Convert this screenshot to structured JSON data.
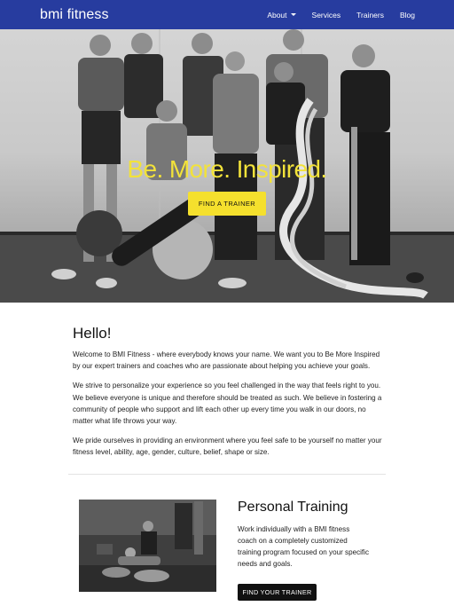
{
  "navbar": {
    "brand": "bmi fitness",
    "items": [
      {
        "label": "About",
        "has_dropdown": true
      },
      {
        "label": "Services"
      },
      {
        "label": "Trainers"
      },
      {
        "label": "Blog"
      }
    ]
  },
  "hero": {
    "title": "Be. More. Inspired.",
    "button_label": "FIND A TRAINER"
  },
  "intro": {
    "heading": "Hello!",
    "paragraphs": [
      "Welcome to BMI Fitness - where everybody knows your name. We want you to Be More Inspired by our expert trainers and coaches who are passionate about helping you achieve your goals.",
      "We strive to personalize your experience so you feel challenged in the way that feels right to you. We believe everyone is unique and therefore should be treated as such. We believe in fostering a community of people who support and lift each other up every time you walk in our doors, no matter what life throws your way.",
      "We pride ourselves in providing an environment where you feel safe to be yourself no matter your fitness level, ability, age, gender, culture, belief, shape or size."
    ]
  },
  "personal_training": {
    "title": "Personal Training",
    "description": "Work individually with a BMI fitness coach on a completely customized training program focused on your specific needs and goals.",
    "button_label": "FIND YOUR TRAINER"
  },
  "colors": {
    "navbar_bg": "#273c9f",
    "accent_yellow": "#f5e02d",
    "hero_title": "#f2e23a",
    "button_dark": "#111111"
  }
}
